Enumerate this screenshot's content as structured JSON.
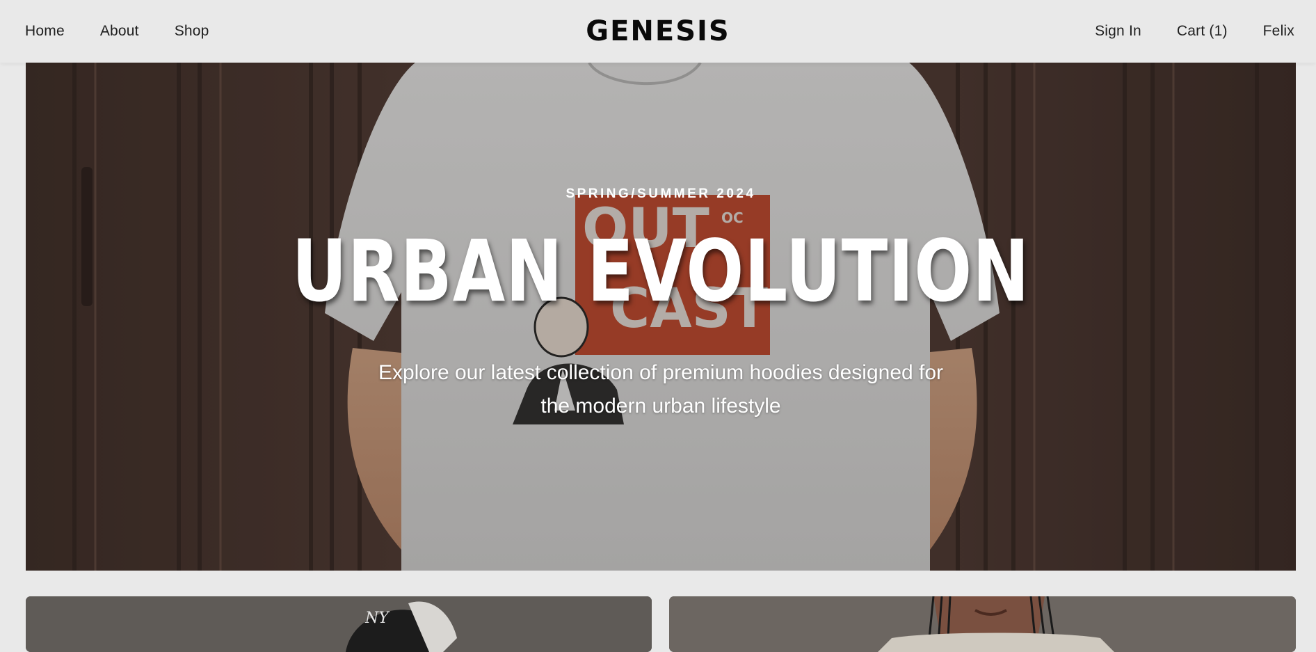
{
  "nav": {
    "left_links": [
      "Home",
      "About",
      "Shop"
    ],
    "brand": "GENESIS",
    "right_links": [
      "Sign In",
      "Cart (1)",
      "Felix"
    ]
  },
  "hero": {
    "eyebrow": "SPRING/SUMMER 2024",
    "title": "URBAN EVOLUTION",
    "subtitle_line1": "Explore our latest collection of premium hoodies designed for",
    "subtitle_line2": "the modern urban lifestyle"
  },
  "colors": {
    "background": "#e9e9e9",
    "text_dark": "#1e1e1e",
    "hero_text": "#ffffff",
    "tshirt_print": "#c8472a"
  }
}
